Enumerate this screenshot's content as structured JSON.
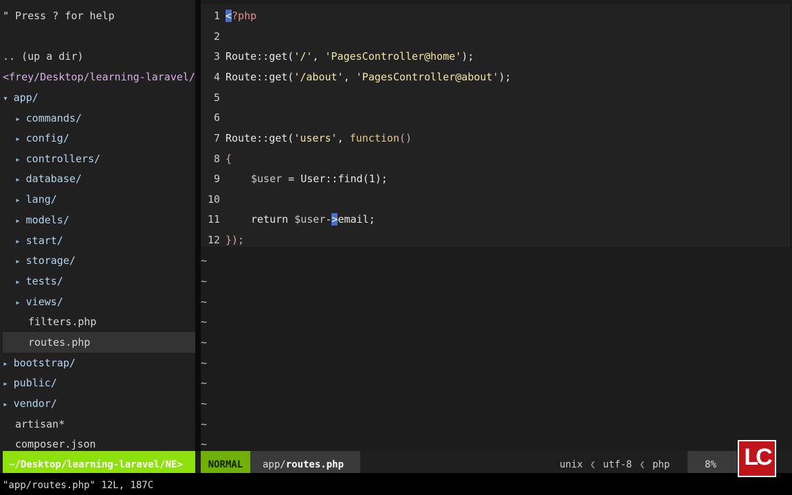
{
  "tree": {
    "help": "\" Press ? for help",
    "up_dir": ".. (up a dir)",
    "cwd": "<frey/Desktop/learning-laravel/",
    "root_dir": "app/",
    "children": [
      "commands/",
      "config/",
      "controllers/",
      "database/",
      "lang/",
      "models/",
      "start/",
      "storage/",
      "tests/",
      "views/"
    ],
    "files": [
      "filters.php",
      "routes.php"
    ],
    "siblings": [
      "bootstrap/",
      "public/",
      "vendor/"
    ],
    "root_files": [
      "artisan*",
      "composer.json"
    ]
  },
  "editor": {
    "line_numbers": [
      "1",
      "2",
      "3",
      "4",
      "5",
      "6",
      "7",
      "8",
      "9",
      "10",
      "11",
      "12"
    ],
    "line1": {
      "cursor": "<",
      "rest": "?php"
    },
    "line3": {
      "a": "Route::get(",
      "b": "'/'",
      "c": ", ",
      "d": "'PagesController@home'",
      "e": ");"
    },
    "line4": {
      "a": "Route::get(",
      "b": "'/about'",
      "c": ", ",
      "d": "'PagesController@about'",
      "e": ");"
    },
    "line7": {
      "a": "Route::get(",
      "b": "'users'",
      "c": ", ",
      "d": "function",
      "e": "()"
    },
    "line8": "{",
    "line9": {
      "a": "$user",
      "b": " = User::",
      "c": "find",
      "d": "(1);"
    },
    "line11": {
      "a": "return ",
      "b": "$user",
      "c": "-",
      "d": ">",
      "e": "email;"
    },
    "line12": "});",
    "tilde": "~"
  },
  "status": {
    "path": "~/Desktop/learning-laravel/NE>",
    "mode": "NORMAL",
    "file_dir": "app/",
    "file_name": "routes.php",
    "format": "unix",
    "encoding": "utf-8",
    "filetype": "php",
    "percent": "8%"
  },
  "cmdline": "\"app/routes.php\" 12L, 187C",
  "logo": "LC"
}
